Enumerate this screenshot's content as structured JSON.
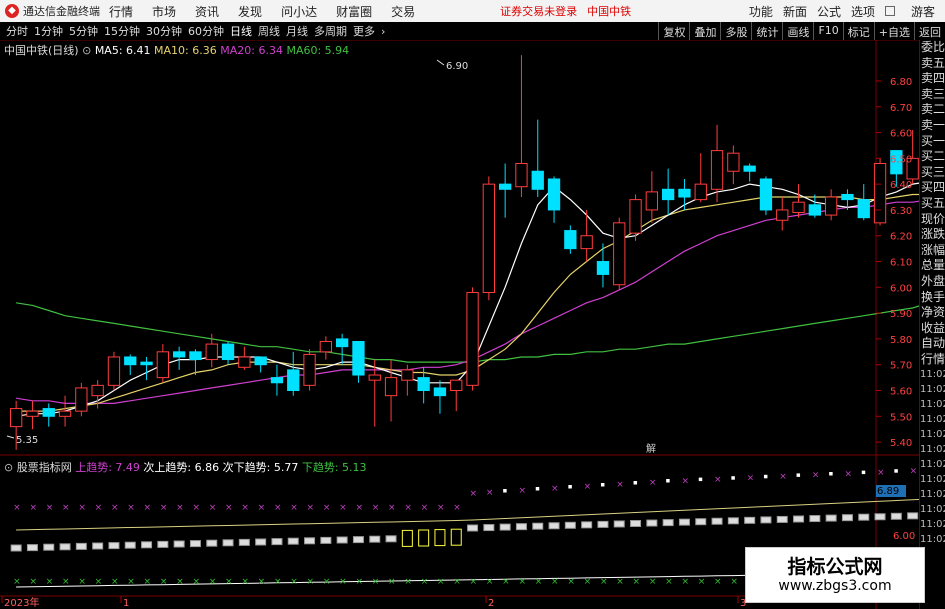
{
  "titlebar": {
    "app_name": "通达信金融终端",
    "menus": [
      "行情",
      "市场",
      "资讯",
      "发现",
      "问小达",
      "财富圈",
      "交易"
    ],
    "notice": "证券交易未登录",
    "stock": "中国中铁",
    "right_menus": [
      "功能",
      "新面",
      "公式",
      "选项"
    ],
    "guest": "游客"
  },
  "toolbar": {
    "periods": [
      "分时",
      "1分钟",
      "5分钟",
      "15分钟",
      "30分钟",
      "60分钟",
      "日线",
      "周线",
      "月线",
      "多周期",
      "更多"
    ],
    "active_period": "日线",
    "right_buttons": [
      "复权",
      "叠加",
      "多股",
      "统计",
      "画线",
      "F10",
      "标记",
      "+自选",
      "返回"
    ]
  },
  "legend": {
    "title": "中国中铁(日线)",
    "ma5": "MA5: 6.41",
    "ma10": "MA10: 6.36",
    "ma20": "MA20: 6.34",
    "ma60": "MA60: 5.94"
  },
  "indicator": {
    "title": "股票指标网",
    "upper": "上趋势: 7.49",
    "sub_upper": "次上趋势: 6.86",
    "sub_lower": "次下趋势: 5.77",
    "lower": "下趋势: 5.13",
    "right_value": "6.89",
    "axis_value": "6.00"
  },
  "annotations": {
    "high": "6.90",
    "low": "5.35",
    "marker": "解"
  },
  "y_axis": [
    "6.80",
    "6.70",
    "6.60",
    "6.50",
    "6.40",
    "6.30",
    "6.20",
    "6.10",
    "6.00",
    "5.90",
    "5.80",
    "5.70",
    "5.60",
    "5.50",
    "5.40"
  ],
  "x_axis": {
    "year": "2023年",
    "m1": "1",
    "m2": "2",
    "m3": "3"
  },
  "right_panel": [
    "委比",
    "卖五",
    "卖四",
    "卖三",
    "卖二",
    "卖一",
    "买一",
    "买二",
    "买三",
    "买四",
    "买五",
    "现价",
    "涨跌",
    "涨幅",
    "总量",
    "外盘",
    "换手",
    "净资",
    "收益",
    "自动",
    "行情"
  ],
  "right_times": [
    "11:02",
    "11:02",
    "11:02",
    "11:02",
    "11:02",
    "11:02",
    "11:02",
    "11:02",
    "11:02",
    "11:02",
    "11:02",
    "11:02"
  ],
  "watermark": {
    "line1": "指标公式网",
    "line2": "www.zbgs3.com"
  },
  "colors": {
    "up": "#ff3d3d",
    "down": "#00e0ff",
    "ma5": "#ffffff",
    "ma10": "#e6d36a",
    "ma20": "#d040d0",
    "ma60": "#40c040"
  },
  "chart_data": {
    "type": "candlestick",
    "title": "中国中铁(日线)",
    "ylim": [
      5.35,
      6.92
    ],
    "candles": [
      [
        5.46,
        5.53,
        5.56,
        5.37
      ],
      [
        5.5,
        5.52,
        5.56,
        5.45
      ],
      [
        5.53,
        5.5,
        5.55,
        5.46
      ],
      [
        5.5,
        5.52,
        5.58,
        5.46
      ],
      [
        5.52,
        5.61,
        5.63,
        5.5
      ],
      [
        5.58,
        5.62,
        5.64,
        5.53
      ],
      [
        5.62,
        5.73,
        5.75,
        5.6
      ],
      [
        5.73,
        5.7,
        5.74,
        5.66
      ],
      [
        5.71,
        5.7,
        5.73,
        5.64
      ],
      [
        5.65,
        5.75,
        5.78,
        5.63
      ],
      [
        5.75,
        5.73,
        5.77,
        5.68
      ],
      [
        5.75,
        5.72,
        5.76,
        5.66
      ],
      [
        5.72,
        5.78,
        5.82,
        5.69
      ],
      [
        5.78,
        5.72,
        5.79,
        5.7
      ],
      [
        5.69,
        5.73,
        5.77,
        5.68
      ],
      [
        5.73,
        5.7,
        5.73,
        5.67
      ],
      [
        5.65,
        5.63,
        5.7,
        5.58
      ],
      [
        5.68,
        5.6,
        5.75,
        5.58
      ],
      [
        5.62,
        5.74,
        5.76,
        5.6
      ],
      [
        5.75,
        5.79,
        5.81,
        5.72
      ],
      [
        5.8,
        5.77,
        5.82,
        5.7
      ],
      [
        5.79,
        5.66,
        5.79,
        5.63
      ],
      [
        5.64,
        5.66,
        5.72,
        5.46
      ],
      [
        5.58,
        5.65,
        5.72,
        5.48
      ],
      [
        5.64,
        5.68,
        5.7,
        5.58
      ],
      [
        5.65,
        5.6,
        5.69,
        5.55
      ],
      [
        5.61,
        5.58,
        5.64,
        5.51
      ],
      [
        5.6,
        5.64,
        5.64,
        5.52
      ],
      [
        5.62,
        5.98,
        6.0,
        5.6
      ],
      [
        5.98,
        6.4,
        6.43,
        5.95
      ],
      [
        6.4,
        6.38,
        6.48,
        6.27
      ],
      [
        6.39,
        6.48,
        6.9,
        6.35
      ],
      [
        6.45,
        6.38,
        6.65,
        6.35
      ],
      [
        6.42,
        6.3,
        6.43,
        6.25
      ],
      [
        6.22,
        6.15,
        6.24,
        6.13
      ],
      [
        6.15,
        6.2,
        6.3,
        6.1
      ],
      [
        6.1,
        6.05,
        6.17,
        6.0
      ],
      [
        6.01,
        6.25,
        6.27,
        5.99
      ],
      [
        6.21,
        6.34,
        6.36,
        6.18
      ],
      [
        6.3,
        6.37,
        6.45,
        6.25
      ],
      [
        6.38,
        6.34,
        6.46,
        6.28
      ],
      [
        6.38,
        6.35,
        6.42,
        6.3
      ],
      [
        6.34,
        6.4,
        6.52,
        6.33
      ],
      [
        6.38,
        6.53,
        6.63,
        6.33
      ],
      [
        6.45,
        6.52,
        6.55,
        6.4
      ],
      [
        6.47,
        6.45,
        6.48,
        6.41
      ],
      [
        6.42,
        6.3,
        6.43,
        6.28
      ],
      [
        6.26,
        6.3,
        6.35,
        6.22
      ],
      [
        6.29,
        6.33,
        6.4,
        6.27
      ],
      [
        6.32,
        6.28,
        6.36,
        6.27
      ],
      [
        6.28,
        6.35,
        6.38,
        6.26
      ],
      [
        6.36,
        6.34,
        6.38,
        6.3
      ],
      [
        6.34,
        6.27,
        6.4,
        6.26
      ],
      [
        6.25,
        6.48,
        6.5,
        6.24
      ],
      [
        6.53,
        6.44,
        6.53,
        6.39
      ],
      [
        6.42,
        6.5,
        6.61,
        6.4
      ],
      [
        6.45,
        6.42,
        6.46,
        6.38
      ]
    ],
    "ma5": [
      5.5,
      5.51,
      5.51,
      5.52,
      5.54,
      5.56,
      5.6,
      5.64,
      5.67,
      5.7,
      5.72,
      5.72,
      5.73,
      5.73,
      5.73,
      5.73,
      5.71,
      5.69,
      5.68,
      5.69,
      5.71,
      5.71,
      5.69,
      5.67,
      5.65,
      5.63,
      5.63,
      5.63,
      5.7,
      5.85,
      6.0,
      6.17,
      6.32,
      6.39,
      6.34,
      6.28,
      6.21,
      6.19,
      6.2,
      6.24,
      6.28,
      6.32,
      6.35,
      6.37,
      6.38,
      6.4,
      6.39,
      6.38,
      6.36,
      6.33,
      6.32,
      6.31,
      6.32,
      6.35,
      6.37,
      6.4,
      6.41
    ],
    "ma10": [
      5.52,
      5.52,
      5.52,
      5.53,
      5.54,
      5.55,
      5.57,
      5.59,
      5.61,
      5.63,
      5.65,
      5.67,
      5.68,
      5.7,
      5.71,
      5.71,
      5.71,
      5.7,
      5.7,
      5.7,
      5.7,
      5.7,
      5.69,
      5.68,
      5.67,
      5.67,
      5.66,
      5.66,
      5.68,
      5.72,
      5.76,
      5.82,
      5.9,
      5.98,
      6.05,
      6.1,
      6.15,
      6.18,
      6.22,
      6.26,
      6.28,
      6.3,
      6.31,
      6.32,
      6.33,
      6.34,
      6.35,
      6.35,
      6.35,
      6.35,
      6.35,
      6.35,
      6.34,
      6.34,
      6.35,
      6.36,
      6.36
    ],
    "ma20": [
      5.57,
      5.56,
      5.56,
      5.55,
      5.55,
      5.55,
      5.55,
      5.56,
      5.57,
      5.58,
      5.59,
      5.6,
      5.61,
      5.62,
      5.63,
      5.64,
      5.65,
      5.66,
      5.66,
      5.67,
      5.68,
      5.68,
      5.68,
      5.68,
      5.68,
      5.69,
      5.69,
      5.7,
      5.72,
      5.75,
      5.78,
      5.82,
      5.85,
      5.88,
      5.91,
      5.94,
      5.96,
      5.99,
      6.02,
      6.06,
      6.1,
      6.14,
      6.17,
      6.2,
      6.22,
      6.24,
      6.26,
      6.27,
      6.28,
      6.29,
      6.3,
      6.31,
      6.31,
      6.32,
      6.33,
      6.33,
      6.34
    ],
    "ma60": [
      5.94,
      5.93,
      5.91,
      5.89,
      5.88,
      5.87,
      5.86,
      5.85,
      5.84,
      5.83,
      5.82,
      5.81,
      5.8,
      5.79,
      5.78,
      5.77,
      5.77,
      5.76,
      5.75,
      5.75,
      5.74,
      5.73,
      5.72,
      5.72,
      5.71,
      5.71,
      5.71,
      5.71,
      5.71,
      5.72,
      5.72,
      5.73,
      5.73,
      5.74,
      5.74,
      5.75,
      5.75,
      5.76,
      5.76,
      5.77,
      5.78,
      5.78,
      5.79,
      5.8,
      5.81,
      5.82,
      5.83,
      5.84,
      5.85,
      5.86,
      5.87,
      5.88,
      5.89,
      5.9,
      5.91,
      5.92,
      5.94
    ]
  }
}
